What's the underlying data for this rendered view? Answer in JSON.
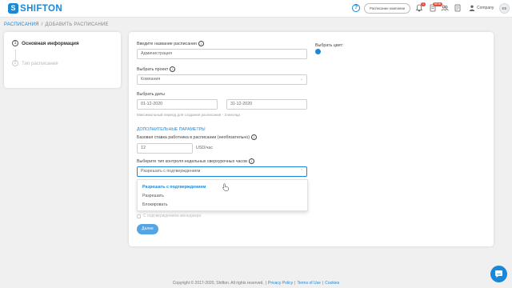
{
  "header": {
    "logo_letter": "S",
    "logo_text": "SHIFTON",
    "help_glyph": "?",
    "company_button": "Расписание компании",
    "bell_badge": "1",
    "doc_badge": "NEW",
    "company_name": "Company",
    "avatar_initials": "EE",
    "icons": [
      "help-icon",
      "bell-icon",
      "document-icon",
      "users-icon",
      "list-icon",
      "user-icon"
    ]
  },
  "breadcrumb": {
    "root": "РАСПИСАНИЯ",
    "separator": "/",
    "current": "ДОБАВИТЬ РАСПИСАНИЕ"
  },
  "steps": [
    {
      "num": "1",
      "label": "Основная информация",
      "active": true
    },
    {
      "num": "2",
      "label": "Тип расписания",
      "active": false
    }
  ],
  "form": {
    "name_label": "Введите название расписания",
    "name_value": "Администрация",
    "color_label": "Выбрать цвет:",
    "color_value": "#1a88d8",
    "project_label": "Выбрать проект",
    "project_value": "Компания",
    "dates_label": "Выбрать даты",
    "date_from": "01-12-2020",
    "date_to": "31-12-2020",
    "dates_hint": "Максимальный период для создания расписания - 3 месяца",
    "extra_title": "ДОПОЛНИТЕЛЬНЫЕ ПАРАМЕТРЫ",
    "rate_label": "Базовая ставка работника в расписании (необязательно)",
    "rate_value": "12",
    "rate_unit": "USD/час",
    "overtime_label": "Выберите тип контроля недельных сверхурочных часов",
    "overtime_value": "Разрешать с подтверждением",
    "overtime_options": [
      "Разрешать с подтверждением",
      "Разрешать",
      "Блокировать"
    ],
    "overtime_selected_index": 0,
    "checkbox_label": "С подтверждением менеджера",
    "next_button": "Далее"
  },
  "footer": {
    "copyright": "Copyright © 2017-2020, Shifton. All rights reserved.",
    "links": [
      "Privacy Policy",
      "Terms of Use",
      "Cookies"
    ]
  },
  "colors": {
    "accent": "#1a88d8",
    "badge": "#e84c3d",
    "button": "#52a6e3"
  }
}
